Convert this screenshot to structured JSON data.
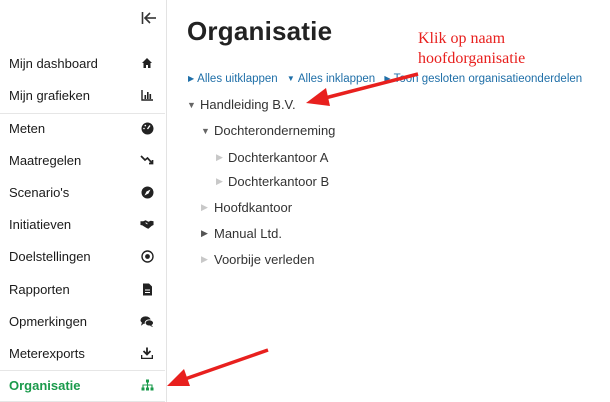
{
  "sidebar": {
    "items": [
      {
        "label": "Mijn dashboard",
        "icon": "home-icon"
      },
      {
        "label": "Mijn grafieken",
        "icon": "bar-chart-icon"
      },
      {
        "label": "Meten",
        "icon": "gauge-icon"
      },
      {
        "label": "Maatregelen",
        "icon": "trend-down-icon"
      },
      {
        "label": "Scenario's",
        "icon": "compass-icon"
      },
      {
        "label": "Initiatieven",
        "icon": "handshake-icon"
      },
      {
        "label": "Doelstellingen",
        "icon": "target-icon"
      },
      {
        "label": "Rapporten",
        "icon": "document-icon"
      },
      {
        "label": "Opmerkingen",
        "icon": "comments-icon"
      },
      {
        "label": "Meterexports",
        "icon": "download-icon"
      },
      {
        "label": "Organisatie",
        "icon": "org-chart-icon",
        "active": true
      }
    ],
    "active_color": "#1a9a4b"
  },
  "main": {
    "title": "Organisatie",
    "toolbar": {
      "expand_all": "Alles uitklappen",
      "collapse_all": "Alles inklappen",
      "show_closed": "Toon gesloten organisatieonderdelen"
    },
    "tree": [
      {
        "label": "Handleiding B.V.",
        "state": "expanded"
      },
      {
        "label": "Dochteronderneming",
        "state": "expanded"
      },
      {
        "label": "Dochterkantoor A",
        "state": "leaf"
      },
      {
        "label": "Dochterkantoor B",
        "state": "leaf"
      },
      {
        "label": "Hoofdkantoor",
        "state": "leaf"
      },
      {
        "label": "Manual Ltd.",
        "state": "collapsed"
      },
      {
        "label": "Voorbije verleden",
        "state": "leaf"
      }
    ]
  },
  "annotation": {
    "line1": "Klik op naam",
    "line2": "hoofdorganisatie",
    "color": "#e8201e"
  }
}
